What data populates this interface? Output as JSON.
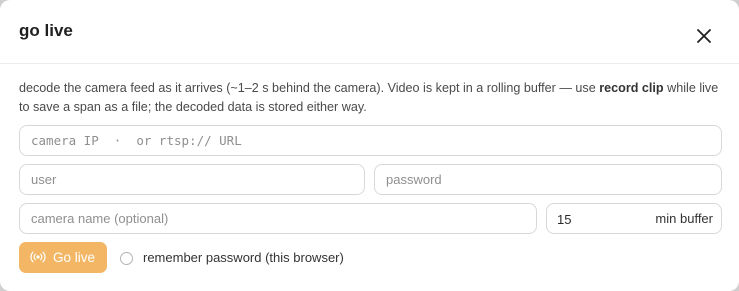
{
  "dialog": {
    "title": "go live",
    "close_icon": "close-icon"
  },
  "description": {
    "part1": "decode the camera feed as it arrives (~1–2 s behind the camera). Video is kept in a rolling buffer — use ",
    "bold": "record clip",
    "part2": " while live to save a span as a file; the decoded data is stored either way."
  },
  "form": {
    "camera_url": {
      "value": "",
      "placeholder": "camera IP  ·  or rtsp:// URL"
    },
    "user": {
      "value": "",
      "placeholder": "user"
    },
    "password": {
      "value": "",
      "placeholder": "password"
    },
    "camera_name": {
      "value": "",
      "placeholder": "camera name (optional)"
    },
    "buffer": {
      "value": "15",
      "unit": "min buffer"
    }
  },
  "actions": {
    "go_live_label": "Go live",
    "go_live_icon": "broadcast-icon",
    "remember_label": "remember password (this browser)",
    "remember_checked": false
  },
  "colors": {
    "accent": "#f2b664"
  }
}
